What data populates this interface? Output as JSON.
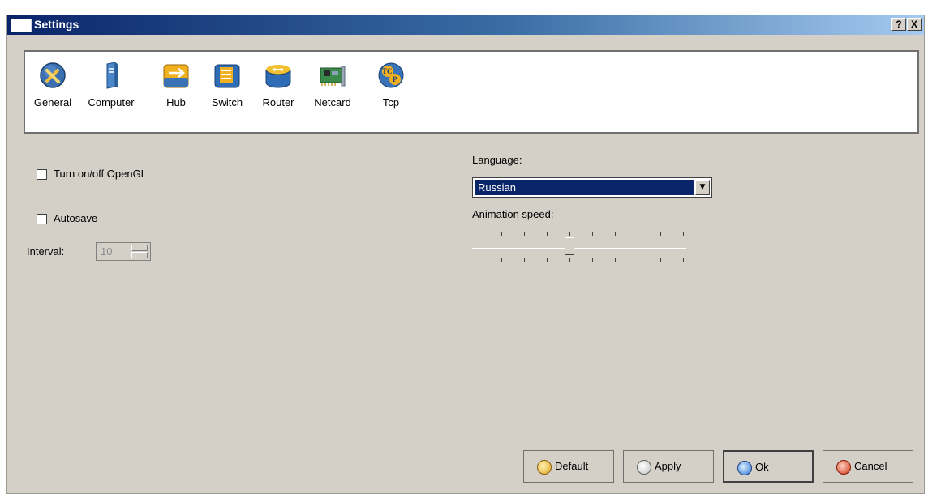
{
  "window": {
    "title": "Settings",
    "help_label": "?",
    "close_label": "X"
  },
  "categories": [
    {
      "label": "General",
      "icon": "tools-icon"
    },
    {
      "label": "Computer",
      "icon": "computer-tower-icon"
    },
    {
      "label": "Hub",
      "icon": "hub-icon"
    },
    {
      "label": "Switch",
      "icon": "switch-icon"
    },
    {
      "label": "Router",
      "icon": "router-icon"
    },
    {
      "label": "Netcard",
      "icon": "netcard-icon"
    },
    {
      "label": "Tcp",
      "icon": "tcp-icon"
    }
  ],
  "options": {
    "opengl_label": "Turn on/off OpenGL",
    "opengl_checked": false,
    "autosave_label": "Autosave",
    "autosave_checked": false,
    "interval_label": "Interval:",
    "interval_value": "10"
  },
  "language": {
    "label": "Language:",
    "selected": "Russian"
  },
  "animation": {
    "label": "Animation speed:",
    "value": 4,
    "min": 0,
    "max": 9
  },
  "buttons": {
    "default_label": "Default",
    "apply_label": "Apply",
    "ok_label": "Ok",
    "cancel_label": "Cancel"
  },
  "colors": {
    "title_bar": "#0a246a",
    "selection": "#0a246a",
    "dialog_bg": "#d4d0c8"
  }
}
